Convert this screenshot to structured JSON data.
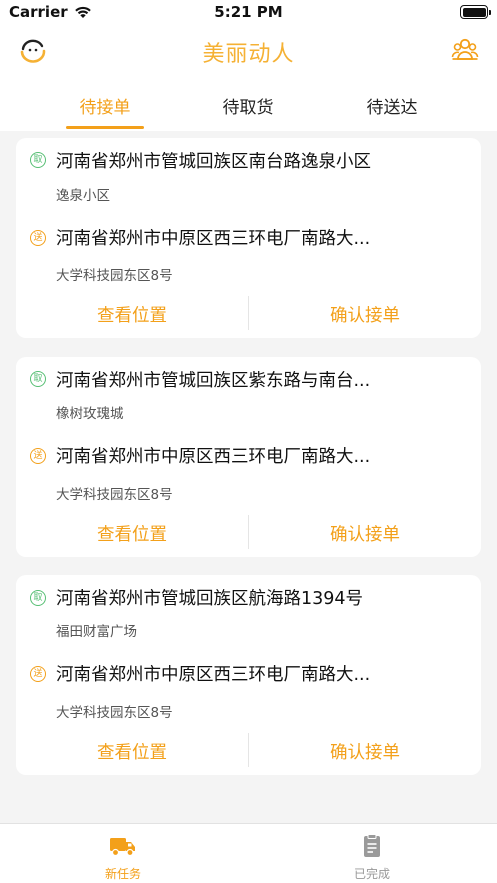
{
  "status": {
    "carrier": "Carrier",
    "time": "5:21 PM"
  },
  "header": {
    "title": "美丽动人",
    "left_icon": "smile-logo-icon",
    "right_icon": "users-icon"
  },
  "tabs": [
    {
      "label": "待接单",
      "active": true
    },
    {
      "label": "待取货",
      "active": false
    },
    {
      "label": "待送达",
      "active": false
    }
  ],
  "badges": {
    "pick": "取",
    "drop": "送"
  },
  "orders": [
    {
      "pickup_address": "河南省郑州市管城回族区南台路逸泉小区",
      "pickup_place": "逸泉小区",
      "drop_address": "河南省郑州市中原区西三环电厂南路大...",
      "drop_place": "大学科技园东区8号",
      "view_label": "查看位置",
      "accept_label": "确认接单"
    },
    {
      "pickup_address": "河南省郑州市管城回族区紫东路与南台...",
      "pickup_place": "橡树玫瑰城",
      "drop_address": "河南省郑州市中原区西三环电厂南路大...",
      "drop_place": "大学科技园东区8号",
      "view_label": "查看位置",
      "accept_label": "确认接单"
    },
    {
      "pickup_address": "河南省郑州市管城回族区航海路1394号",
      "pickup_place": "福田财富广场",
      "drop_address": "河南省郑州市中原区西三环电厂南路大...",
      "drop_place": "大学科技园东区8号",
      "view_label": "查看位置",
      "accept_label": "确认接单"
    }
  ],
  "bottom_tabs": [
    {
      "label": "新任务",
      "icon": "truck-icon",
      "active": true
    },
    {
      "label": "已完成",
      "icon": "clipboard-icon",
      "active": false
    }
  ],
  "colors": {
    "accent": "#f3a01a",
    "title": "#f5b134",
    "pickup": "#57bf74"
  }
}
